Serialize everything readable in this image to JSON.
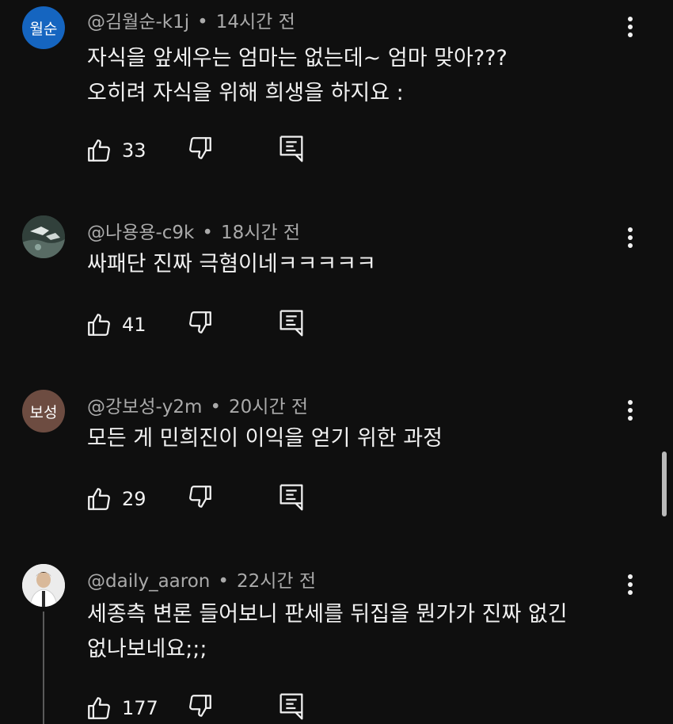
{
  "comments": [
    {
      "avatar_text": "월순",
      "avatar_color": "#1565c0",
      "author": "@김월순-k1j",
      "time": "14시간 전",
      "lines": [
        "자식을 앞세우는 엄마는 없는데~ 엄마 맞아???",
        "오히려 자식을 위해 희생을 하지요 :"
      ],
      "likes": "33"
    },
    {
      "avatar_text": "",
      "avatar_color": "#3b4a45",
      "author": "@나용용-c9k",
      "time": "18시간 전",
      "lines": [
        "싸패단 진짜 극혐이네ㅋㅋㅋㅋㅋ"
      ],
      "likes": "41"
    },
    {
      "avatar_text": "보성",
      "avatar_color": "#6d4c41",
      "author": "@강보성-y2m",
      "time": "20시간 전",
      "lines": [
        "모든 게 민희진이 이익을 얻기 위한 과정"
      ],
      "likes": "29"
    },
    {
      "avatar_text": "",
      "avatar_color": "#e8e8e8",
      "author": "@daily_aaron",
      "time": "22시간 전",
      "lines": [
        "세종측 변론 들어보니 판세를 뒤집을 뭔가가 진짜 없긴",
        "없나보네요;;;"
      ],
      "likes": "177"
    }
  ],
  "icons": {
    "like": "thumbs-up-icon",
    "dislike": "thumbs-down-icon",
    "reply": "reply-comment-icon",
    "more": "more-vert-icon"
  }
}
